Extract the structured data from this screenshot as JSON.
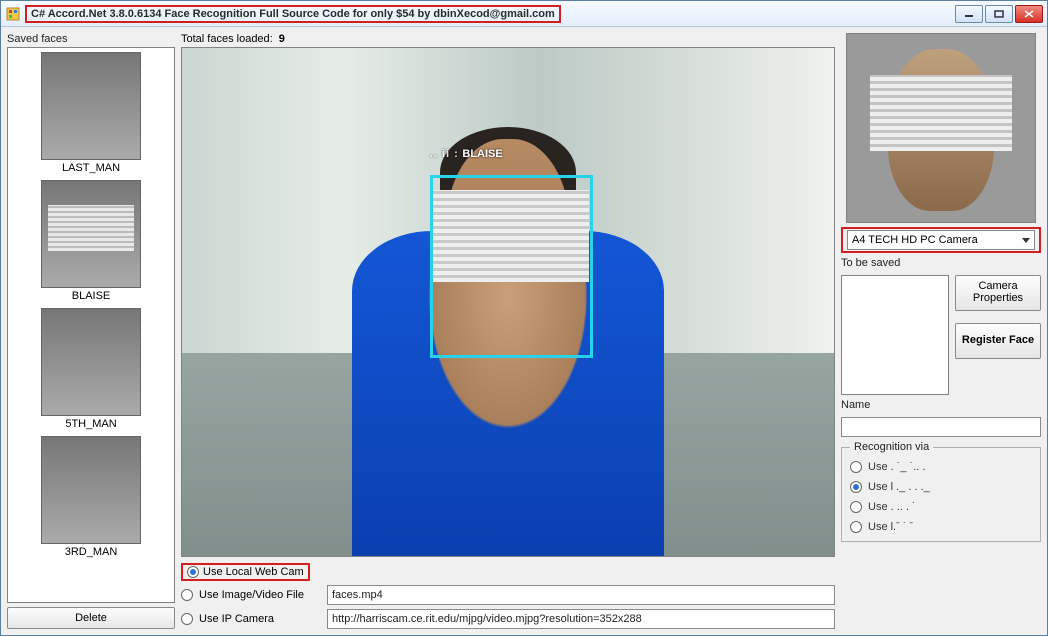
{
  "window": {
    "title": "C# Accord.Net 3.8.0.6134 Face Recognition Full Source Code for only $54 by dbinXecod@gmail.com"
  },
  "left": {
    "header": "Saved faces",
    "faces": [
      {
        "name": "LAST_MAN",
        "censored": false
      },
      {
        "name": "BLAISE",
        "censored": true
      },
      {
        "name": "5TH_MAN",
        "censored": false
      },
      {
        "name": "3RD_MAN",
        "censored": false
      }
    ],
    "delete_label": "Delete"
  },
  "mid": {
    "total_label": "Total faces loaded:",
    "total_value": "9",
    "detected_prefix": ".. ii :",
    "detected_name": "BLAISE",
    "source": {
      "local": "Use Local Web Cam",
      "file_label": "Use Image/Video File",
      "file_value": "faces.mp4",
      "ip_label": "Use IP Camera",
      "ip_value": "http://harriscam.ce.rit.edu/mjpg/video.mjpg?resolution=352x288"
    }
  },
  "right": {
    "camera_selected": "A4 TECH HD PC Camera",
    "tosave_label": "To be saved",
    "camprops_label": "Camera Properties",
    "register_label": "Register Face",
    "name_label": "Name",
    "recognition": {
      "legend": "Recognition via",
      "opts": [
        "Use .  ˙_ ˙.. .",
        "Use l ._ . . ._",
        "Use . .. .  ˙",
        "Use l.ˉ ˙ ˉ"
      ]
    }
  }
}
